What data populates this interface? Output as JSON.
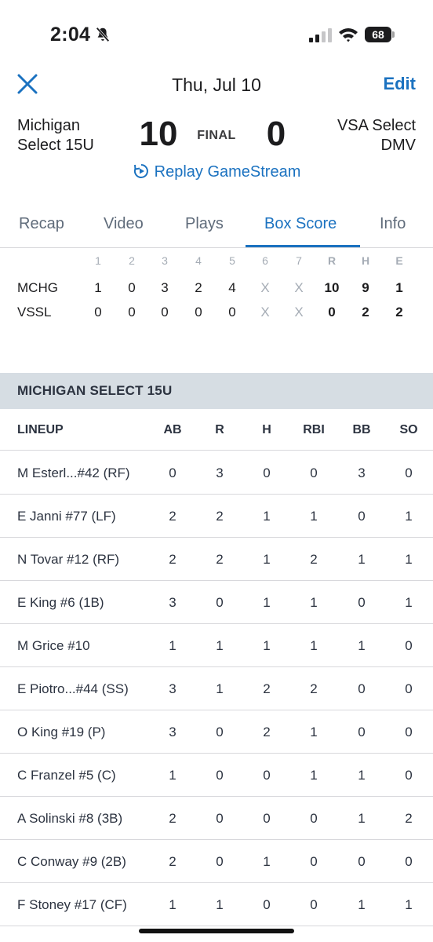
{
  "status_bar": {
    "time": "2:04",
    "battery": "68"
  },
  "header": {
    "date": "Thu, Jul 10",
    "edit_label": "Edit"
  },
  "scoreboard": {
    "home_team_line1": "Michigan",
    "home_team_line2": "Select 15U",
    "home_score": "10",
    "status": "FINAL",
    "away_score": "0",
    "away_team_line1": "VSA Select",
    "away_team_line2": "DMV",
    "replay_label": "Replay GameStream"
  },
  "tabs": [
    {
      "label": "Recap"
    },
    {
      "label": "Video"
    },
    {
      "label": "Plays"
    },
    {
      "label": "Box Score"
    },
    {
      "label": "Info"
    }
  ],
  "active_tab": "Box Score",
  "linescore": {
    "headers": [
      "1",
      "2",
      "3",
      "4",
      "5",
      "6",
      "7",
      "R",
      "H",
      "E"
    ],
    "rows": [
      {
        "team": "MCHG",
        "innings": [
          "1",
          "0",
          "3",
          "2",
          "4",
          "X",
          "X"
        ],
        "r": "10",
        "h": "9",
        "e": "1"
      },
      {
        "team": "VSSL",
        "innings": [
          "0",
          "0",
          "0",
          "0",
          "0",
          "X",
          "X"
        ],
        "r": "0",
        "h": "2",
        "e": "2"
      }
    ]
  },
  "team_section": {
    "title": "MICHIGAN SELECT 15U",
    "lineup_label": "LINEUP",
    "columns": [
      "AB",
      "R",
      "H",
      "RBI",
      "BB",
      "SO"
    ],
    "players": [
      {
        "name": "M Esterl...#42 (RF)",
        "stats": [
          "0",
          "3",
          "0",
          "0",
          "3",
          "0"
        ]
      },
      {
        "name": "E Janni #77 (LF)",
        "stats": [
          "2",
          "2",
          "1",
          "1",
          "0",
          "1"
        ]
      },
      {
        "name": "N Tovar #12 (RF)",
        "stats": [
          "2",
          "2",
          "1",
          "2",
          "1",
          "1"
        ]
      },
      {
        "name": "E King #6 (1B)",
        "stats": [
          "3",
          "0",
          "1",
          "1",
          "0",
          "1"
        ]
      },
      {
        "name": "M Grice #10",
        "stats": [
          "1",
          "1",
          "1",
          "1",
          "1",
          "0"
        ]
      },
      {
        "name": "E Piotro...#44 (SS)",
        "stats": [
          "3",
          "1",
          "2",
          "2",
          "0",
          "0"
        ]
      },
      {
        "name": "O King #19 (P)",
        "stats": [
          "3",
          "0",
          "2",
          "1",
          "0",
          "0"
        ]
      },
      {
        "name": "C Franzel #5 (C)",
        "stats": [
          "1",
          "0",
          "0",
          "1",
          "1",
          "0"
        ]
      },
      {
        "name": "A Solinski #8 (3B)",
        "stats": [
          "2",
          "0",
          "0",
          "0",
          "1",
          "2"
        ]
      },
      {
        "name": "C Conway #9 (2B)",
        "stats": [
          "2",
          "0",
          "1",
          "0",
          "0",
          "0"
        ]
      },
      {
        "name": "F Stoney #17 (CF)",
        "stats": [
          "1",
          "1",
          "0",
          "0",
          "1",
          "1"
        ]
      }
    ]
  },
  "colors": {
    "accent": "#1b72c0",
    "section_bg": "#d6dde3"
  },
  "icons": [
    "bell-slash-icon",
    "signal-icon",
    "wifi-icon",
    "battery-icon",
    "close-icon",
    "replay-icon"
  ]
}
